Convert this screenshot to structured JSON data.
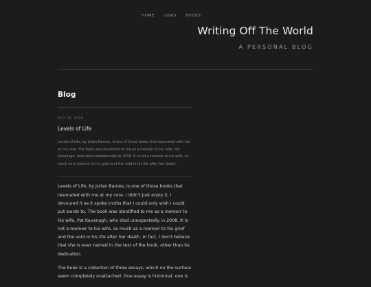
{
  "nav": {
    "home": "HOME",
    "links": "LINKS",
    "books": "BOOKS"
  },
  "site": {
    "title": "Writing Off The World",
    "tagline": "A PERSONAL BLOG"
  },
  "section": {
    "title": "Blog"
  },
  "post": {
    "date": "JULY 31, 2020",
    "title": "Levels of Life",
    "excerpt": "Levels of Life, by Julian Barnes, is one of those books that resonated with me at my core. The book was described to me as a memoir to his wife, Pat Kavanagh, who died unexpectedly in 2008. It is not a memoir to his wife, so much as a memoir to his grief and the void in his life after her death.",
    "paragraphs": [
      "Levels of Life, by Julian Barnes, is one of those books that resonated with me at my core. I didn't just enjoy it, I devoured it as it spoke truths that I could only wish I could put words to. The book was identified to me as a memoir to his wife, Pat Kavanagh, who died unexpectedly in 2008. It is not a memoir to his wife, so much as a memoir to his grief and the void in his life after her death. In fact, I don't believe that she is ever named in the text of the book, other than its dedication.",
      "The book is a collection of three essays, which on the surface seem completely unattached. One essay is historical, one is"
    ]
  }
}
